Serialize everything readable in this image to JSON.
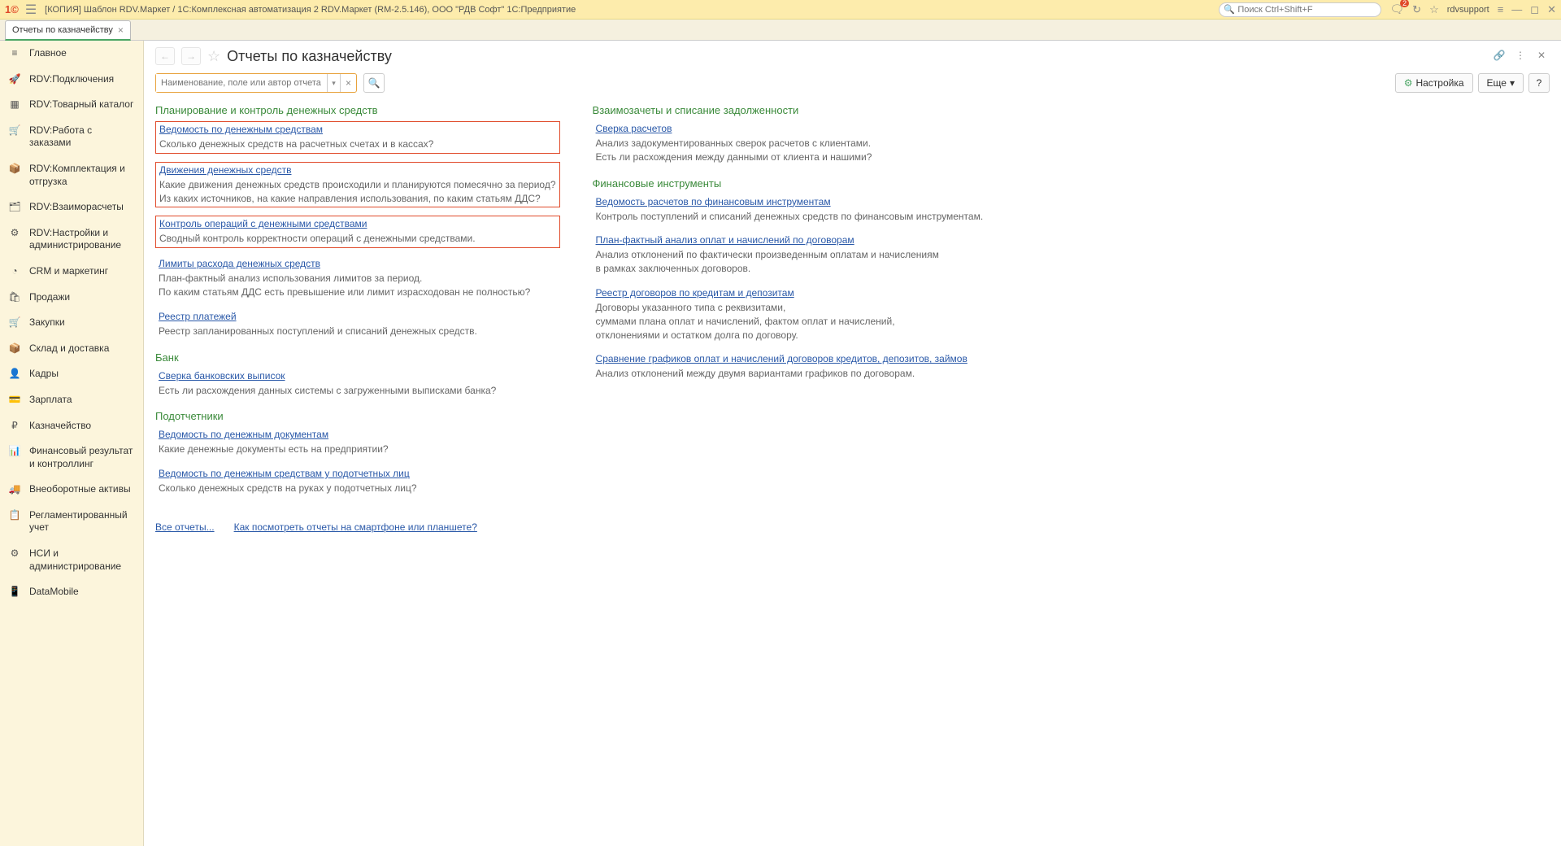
{
  "titlebar": {
    "logo": "1©",
    "title": "[КОПИЯ] Шаблон RDV.Маркет / 1С:Комплексная автоматизация 2 RDV.Маркет (RM-2.5.146), ООО \"РДВ Софт\" 1С:Предприятие",
    "search_placeholder": "Поиск Ctrl+Shift+F",
    "notif_count": "2",
    "user": "rdvsupport"
  },
  "tab": {
    "label": "Отчеты по казначейству"
  },
  "sidebar": {
    "items": [
      {
        "icon": "≡",
        "label": "Главное"
      },
      {
        "icon": "🚀",
        "label": "RDV:Подключения"
      },
      {
        "icon": "▦",
        "label": "RDV:Товарный каталог"
      },
      {
        "icon": "🛒",
        "label": "RDV:Работа с заказами"
      },
      {
        "icon": "📦",
        "label": "RDV:Комплектация и отгрузка"
      },
      {
        "icon": "🗂",
        "label": "RDV:Взаиморасчеты"
      },
      {
        "icon": "⚙",
        "label": "RDV:Настройки и администрирование"
      },
      {
        "icon": "◔",
        "label": "CRM и маркетинг"
      },
      {
        "icon": "🛍",
        "label": "Продажи"
      },
      {
        "icon": "🛒",
        "label": "Закупки"
      },
      {
        "icon": "📦",
        "label": "Склад и доставка"
      },
      {
        "icon": "👤",
        "label": "Кадры"
      },
      {
        "icon": "💳",
        "label": "Зарплата"
      },
      {
        "icon": "₽",
        "label": "Казначейство"
      },
      {
        "icon": "📊",
        "label": "Финансовый результат и контроллинг"
      },
      {
        "icon": "🚚",
        "label": "Внеоборотные активы"
      },
      {
        "icon": "📋",
        "label": "Регламентированный учет"
      },
      {
        "icon": "⚙",
        "label": "НСИ и администрирование"
      },
      {
        "icon": "📱",
        "label": "DataMobile"
      }
    ]
  },
  "page": {
    "title": "Отчеты по казначейству",
    "search_placeholder": "Наименование, поле или автор отчета",
    "settings_btn": "Настройка",
    "more_btn": "Еще"
  },
  "col1": {
    "s1": {
      "title": "Планирование и контроль денежных средств",
      "r1": {
        "link": "Ведомость по денежным средствам",
        "desc": "Сколько денежных средств на расчетных счетах и в кассах?"
      },
      "r2": {
        "link": "Движения денежных средств",
        "desc": "Какие движения денежных средств происходили и планируются помесячно за период?\nИз каких источников, на какие направления использования, по каким статьям ДДС?"
      },
      "r3": {
        "link": "Контроль операций с денежными средствами",
        "desc": "Сводный контроль корректности операций с денежными средствами."
      },
      "r4": {
        "link": "Лимиты расхода денежных средств",
        "desc": "План-фактный анализ использования лимитов за период.\nПо каким статьям ДДС есть превышение или лимит израсходован не полностью?"
      },
      "r5": {
        "link": "Реестр платежей",
        "desc": "Реестр запланированных поступлений и списаний денежных средств."
      }
    },
    "s2": {
      "title": "Банк",
      "r1": {
        "link": "Сверка банковских выписок",
        "desc": "Есть ли расхождения данных системы с загруженными выписками банка?"
      }
    },
    "s3": {
      "title": "Подотчетники",
      "r1": {
        "link": "Ведомость по денежным документам",
        "desc": "Какие денежные документы есть на предприятии?"
      },
      "r2": {
        "link": "Ведомость по денежным средствам у подотчетных лиц",
        "desc": "Сколько денежных средств на руках у подотчетных лиц?"
      }
    },
    "footer": {
      "all": "Все отчеты...",
      "how": "Как посмотреть отчеты на смартфоне или планшете?"
    }
  },
  "col2": {
    "s1": {
      "title": "Взаимозачеты и списание задолженности",
      "r1": {
        "link": "Сверка расчетов",
        "desc": "Анализ задокументированных сверок расчетов с клиентами.\nЕсть ли расхождения между данными от клиента и нашими?"
      }
    },
    "s2": {
      "title": "Финансовые инструменты",
      "r1": {
        "link": "Ведомость расчетов по финансовым инструментам",
        "desc": "Контроль поступлений и списаний денежных средств по финансовым инструментам."
      },
      "r2": {
        "link": "План-фактный анализ оплат и начислений по договорам",
        "desc": "Анализ отклонений по фактически произведенным оплатам и начислениям\nв рамках заключенных договоров."
      },
      "r3": {
        "link": "Реестр договоров по кредитам и депозитам",
        "desc": "Договоры указанного типа с реквизитами,\nсуммами плана оплат и начислений, фактом оплат и начислений,\nотклонениями и остатком долга по договору."
      },
      "r4": {
        "link": "Сравнение графиков оплат и начислений договоров кредитов, депозитов, займов",
        "desc": "Анализ отклонений между двумя вариантами графиков по договорам."
      }
    }
  }
}
